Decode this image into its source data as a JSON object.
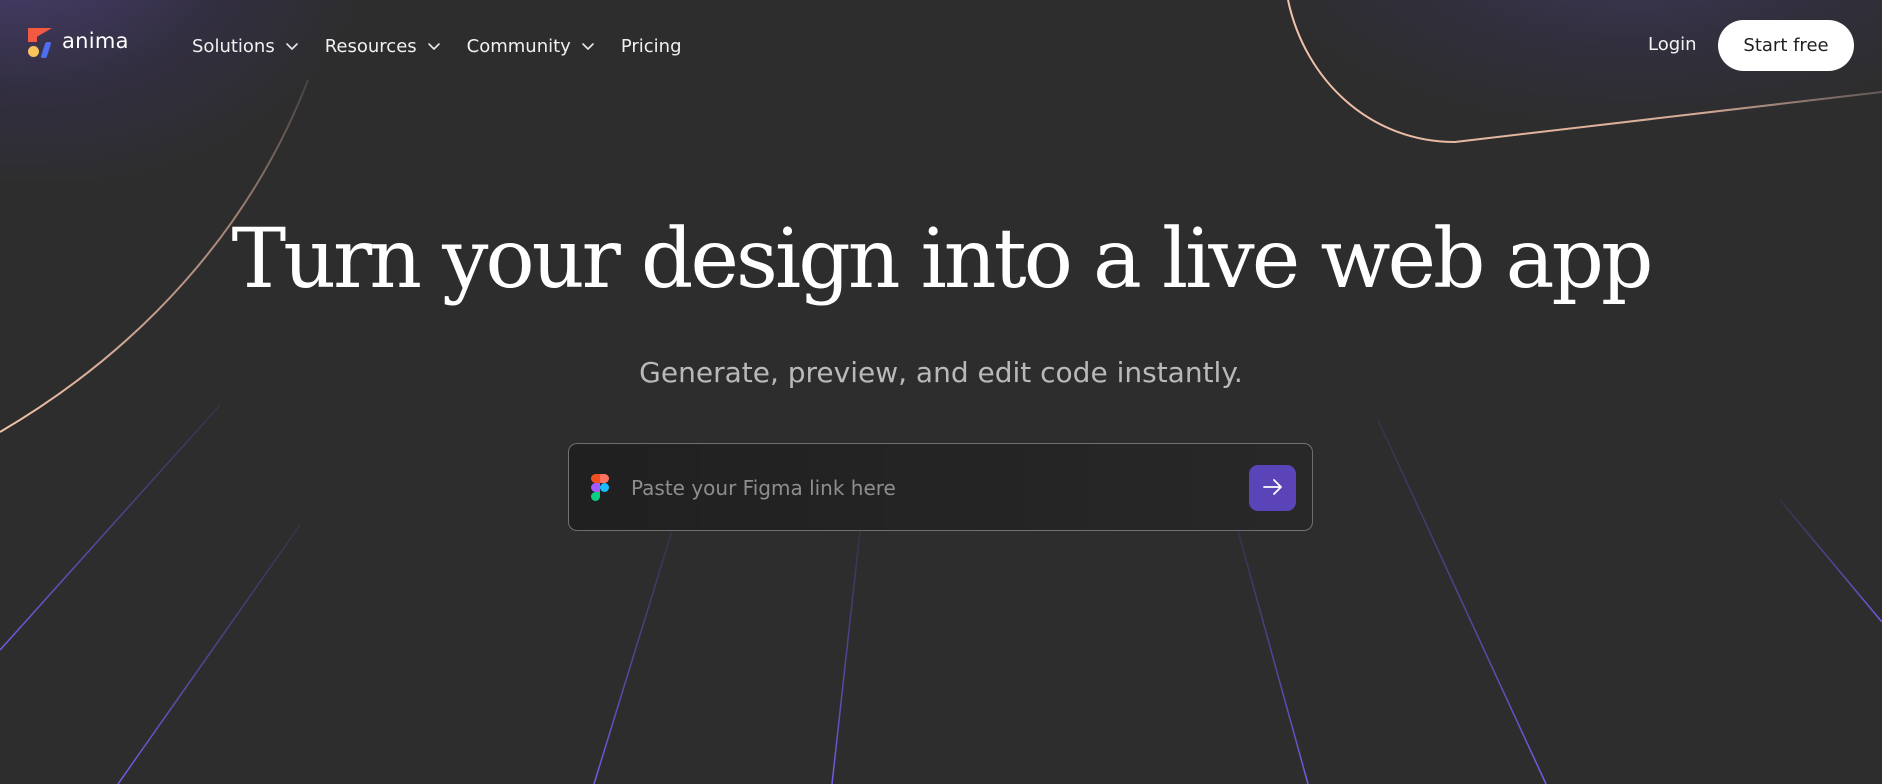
{
  "brand": {
    "name": "anima",
    "logo_colors": [
      "#f25a44",
      "#f7c45d",
      "#4f6df0"
    ]
  },
  "nav": {
    "items": [
      {
        "label": "Solutions",
        "has_dropdown": true
      },
      {
        "label": "Resources",
        "has_dropdown": true
      },
      {
        "label": "Community",
        "has_dropdown": true
      },
      {
        "label": "Pricing",
        "has_dropdown": false
      }
    ]
  },
  "header": {
    "login_label": "Login",
    "start_label": "Start free"
  },
  "hero": {
    "title": "Turn your design into a live web app",
    "subtitle": "Generate, preview, and edit code instantly.",
    "input_placeholder": "Paste your Figma link here",
    "submit_icon": "arrow-right-icon"
  },
  "colors": {
    "background": "#2d2d2d",
    "accent": "#5a44b8",
    "curve": "#f0c0a8",
    "rays": "#6b4fe0"
  }
}
